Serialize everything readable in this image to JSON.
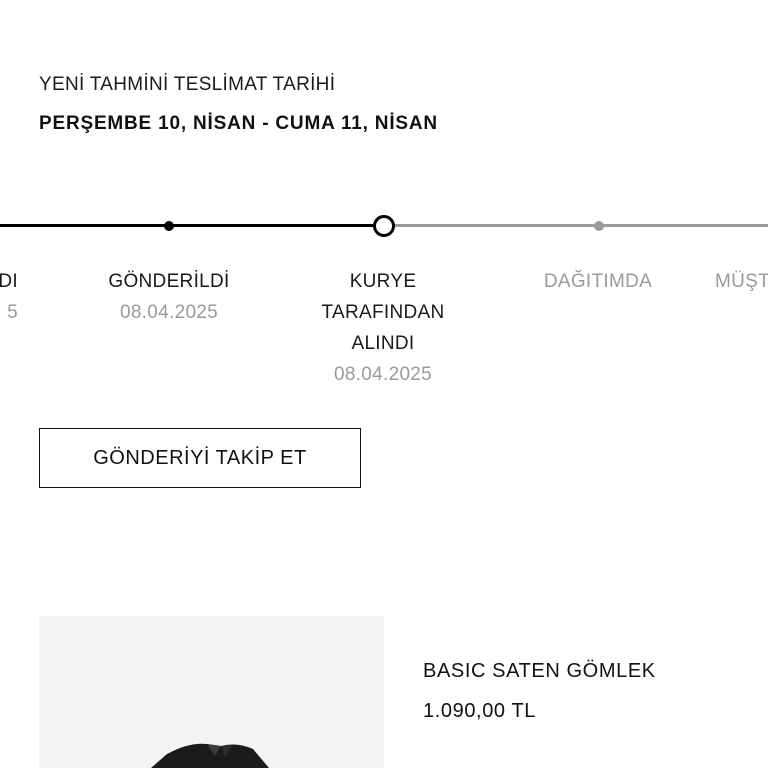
{
  "delivery": {
    "label": "YENİ TAHMİNİ TESLİMAT TARİHİ",
    "date_range": "PERŞEMBE 10, NİSAN - CUMA 11, NİSAN"
  },
  "timeline": {
    "steps": [
      {
        "label": "DI",
        "date": "5",
        "status": "done"
      },
      {
        "label": "GÖNDERİLDİ",
        "date": "08.04.2025",
        "status": "done"
      },
      {
        "label_line1": "KURYE",
        "label_line2": "TARAFINDAN",
        "label_line3": "ALINDI",
        "date": "08.04.2025",
        "status": "current"
      },
      {
        "label": "DAĞITIMDA",
        "date": "",
        "status": "pending"
      },
      {
        "label": "MÜŞT",
        "date": "",
        "status": "pending"
      }
    ],
    "colors": {
      "done": "#000000",
      "pending": "#9a9a9a"
    }
  },
  "actions": {
    "track_button_label": "GÖNDERİYİ TAKİP ET"
  },
  "product": {
    "name": "BASIC SATEN GÖMLEK",
    "price": "1.090,00 TL"
  }
}
